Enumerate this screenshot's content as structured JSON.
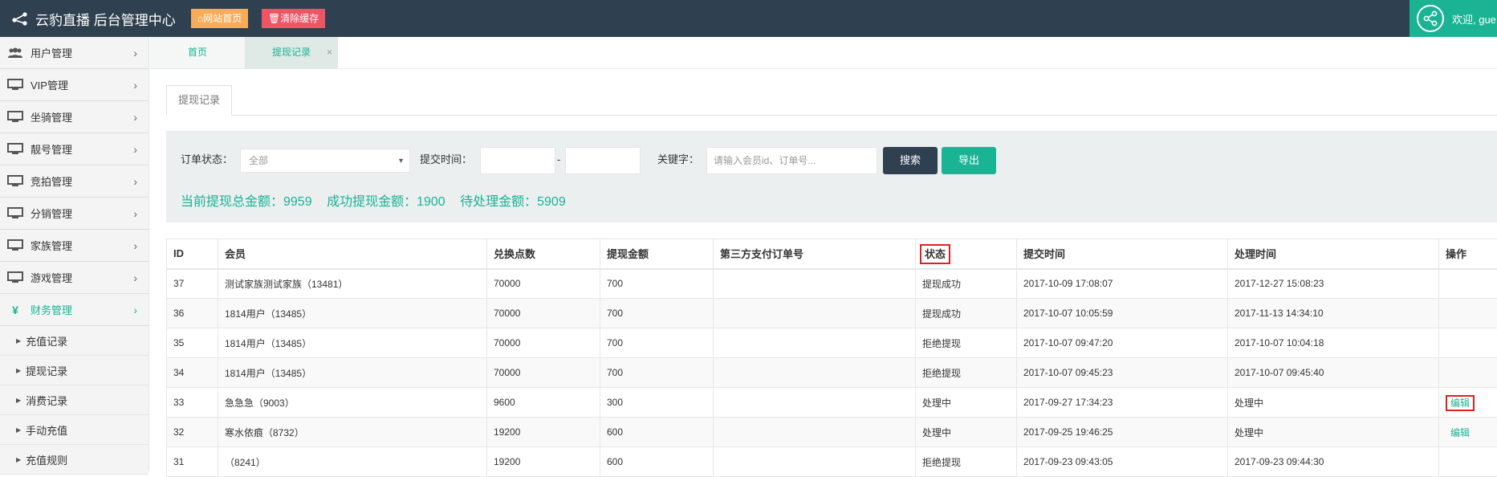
{
  "header": {
    "title": "云豹直播 后台管理中心",
    "home_btn": "网站首页",
    "clear_cache_btn": "清除缓存",
    "welcome": "欢迎, gue"
  },
  "sidebar": {
    "items": [
      {
        "label": "用户管理",
        "icon": "users-icon"
      },
      {
        "label": "VIP管理",
        "icon": "monitor-icon"
      },
      {
        "label": "坐骑管理",
        "icon": "monitor-icon"
      },
      {
        "label": "靓号管理",
        "icon": "monitor-icon"
      },
      {
        "label": "竞拍管理",
        "icon": "monitor-icon"
      },
      {
        "label": "分销管理",
        "icon": "monitor-icon"
      },
      {
        "label": "家族管理",
        "icon": "monitor-icon"
      },
      {
        "label": "游戏管理",
        "icon": "monitor-icon"
      },
      {
        "label": "财务管理",
        "icon": "yen-icon"
      }
    ],
    "sub_items": [
      "充值记录",
      "提现记录",
      "消费记录",
      "手动充值",
      "充值规则"
    ]
  },
  "tabs": [
    {
      "label": "首页"
    },
    {
      "label": "提现记录"
    }
  ],
  "content_tab": "提现记录",
  "filter": {
    "status_label": "订单状态：",
    "status_value": "全部",
    "time_label": "提交时间：",
    "time_sep": "-",
    "keyword_label": "关键字：",
    "keyword_placeholder": "请输入会员id、订单号...",
    "search_btn": "搜索",
    "export_btn": "导出"
  },
  "summary": {
    "total": "当前提现总金额：9959",
    "success": "成功提现金额：1900",
    "pending": "待处理金额：5909"
  },
  "table": {
    "headers": [
      "ID",
      "会员",
      "兑换点数",
      "提现金额",
      "第三方支付订单号",
      "状态",
      "提交时间",
      "处理时间",
      "操作"
    ],
    "rows": [
      {
        "id": "37",
        "member": "测试家族测试家族（13481）",
        "points": "70000",
        "amount": "700",
        "third": "",
        "status": "提现成功",
        "submit": "2017-10-09 17:08:07",
        "process": "2017-12-27 15:08:23",
        "op": ""
      },
      {
        "id": "36",
        "member": "1814用户（13485）",
        "points": "70000",
        "amount": "700",
        "third": "",
        "status": "提现成功",
        "submit": "2017-10-07 10:05:59",
        "process": "2017-11-13 14:34:10",
        "op": ""
      },
      {
        "id": "35",
        "member": "1814用户（13485）",
        "points": "70000",
        "amount": "700",
        "third": "",
        "status": "拒绝提现",
        "submit": "2017-10-07 09:47:20",
        "process": "2017-10-07 10:04:18",
        "op": ""
      },
      {
        "id": "34",
        "member": "1814用户（13485）",
        "points": "70000",
        "amount": "700",
        "third": "",
        "status": "拒绝提现",
        "submit": "2017-10-07 09:45:23",
        "process": "2017-10-07 09:45:40",
        "op": ""
      },
      {
        "id": "33",
        "member": "急急急（9003）",
        "points": "9600",
        "amount": "300",
        "third": "",
        "status": "处理中",
        "submit": "2017-09-27 17:34:23",
        "process": "处理中",
        "op": "编辑"
      },
      {
        "id": "32",
        "member": "寒水依痕（8732）",
        "points": "19200",
        "amount": "600",
        "third": "",
        "status": "处理中",
        "submit": "2017-09-25 19:46:25",
        "process": "处理中",
        "op": "编辑"
      },
      {
        "id": "31",
        "member": "（8241）",
        "points": "19200",
        "amount": "600",
        "third": "",
        "status": "拒绝提现",
        "submit": "2017-09-23 09:43:05",
        "process": "2017-09-23 09:44:30",
        "op": ""
      }
    ]
  },
  "colors": {
    "header_bg": "#2f4050",
    "accent": "#1ab394",
    "home_btn": "#f8ac59",
    "cache_btn": "#ed5565",
    "highlight": "#e02020"
  }
}
